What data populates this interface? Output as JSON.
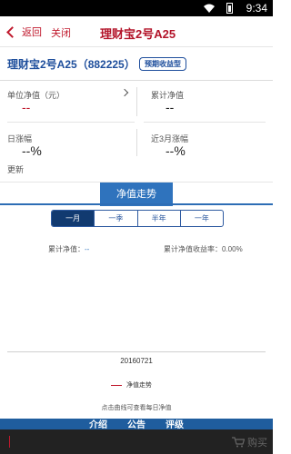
{
  "status_bar": {
    "time": "9:34"
  },
  "nav": {
    "back_label": "返回",
    "close_label": "关闭",
    "title": "理财宝2号A25"
  },
  "product": {
    "name": "理财宝2号A25（882225）",
    "tag": "预期收益型"
  },
  "metrics": {
    "unit_nav_label": "单位净值（元）",
    "unit_nav_value": "--",
    "cumulative_nav_label": "累计净值",
    "cumulative_nav_value": "--",
    "daily_change_label": "日涨幅",
    "daily_change_value": "--%",
    "three_month_change_label": "近3月涨幅",
    "three_month_change_value": "--%",
    "update_label": "更新"
  },
  "chart_section": {
    "title": "净值走势",
    "periods": [
      "一月",
      "一季",
      "半年",
      "一年"
    ],
    "selected_period": "一月",
    "cumulative_nav_label": "累计净值：",
    "cumulative_nav_value": "--",
    "cumulative_return_label": "累计净值收益率：",
    "cumulative_return_value": "0.00%",
    "date": "20160721",
    "legend_label": "净值走势",
    "hint": "点击曲线可查看每日净值",
    "line_color": "#c0192d"
  },
  "bottom_tabs": [
    "介绍",
    "公告",
    "评级"
  ],
  "action_bar": {
    "buy_label": "购买"
  }
}
